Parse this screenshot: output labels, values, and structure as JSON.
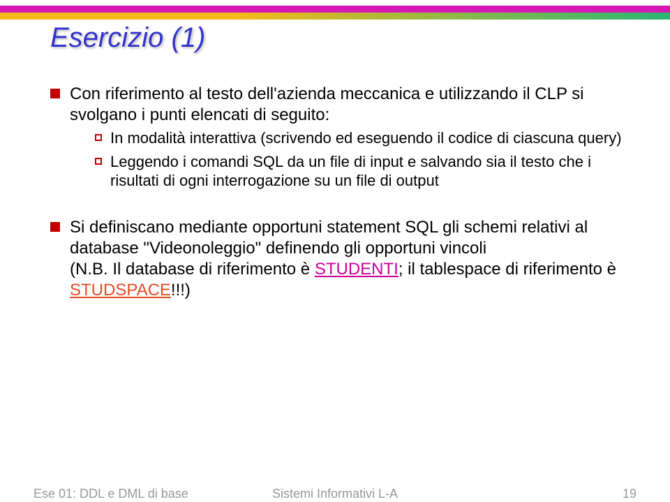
{
  "title": "Esercizio (1)",
  "bullets": {
    "b1": "Con riferimento al testo dell'azienda meccanica e utilizzando il CLP si svolgano i punti elencati di seguito:",
    "b1a": "In modalità interattiva (scrivendo ed  eseguendo il codice di ciascuna query)",
    "b1b": "Leggendo i comandi SQL da un file di input e salvando sia il testo che i risultati di ogni interrogazione su un file di output",
    "b2_part1": "Si definiscano mediante opportuni statement SQL gli schemi relativi al database \"Videonoleggio\" definendo gli opportuni vincoli",
    "b2_nb_prefix": "(N.B. Il database di riferimento è ",
    "b2_link1": "STUDENTI",
    "b2_mid": "; il tablespace di riferimento è ",
    "b2_link2": "STUDSPACE",
    "b2_suffix": "!!!)"
  },
  "footer": {
    "left": "Ese 01: DDL e DML di base",
    "center": "Sistemi Informativi L-A",
    "right": "19"
  }
}
